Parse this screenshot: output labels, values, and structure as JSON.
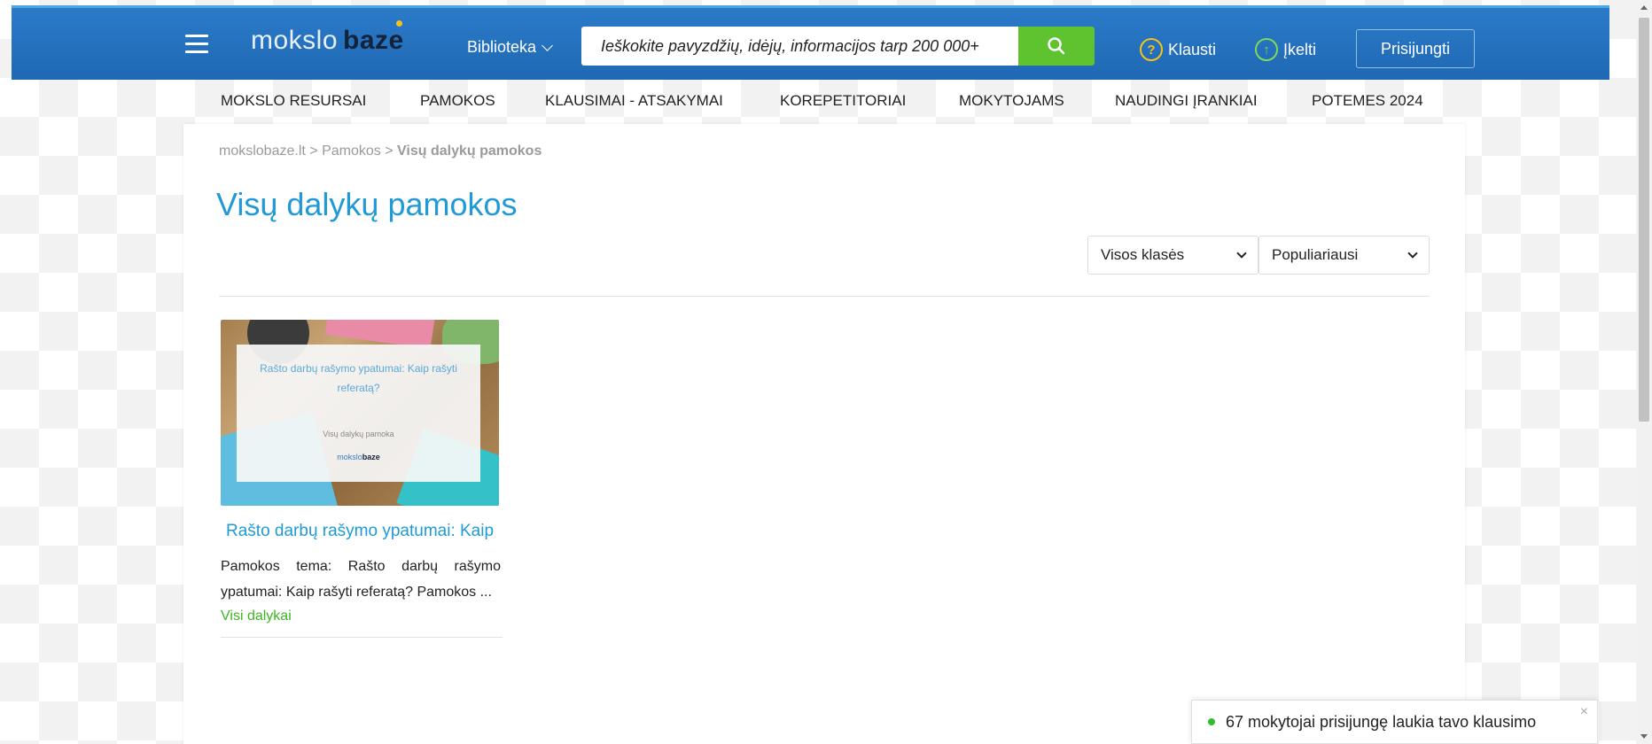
{
  "header": {
    "logo_light": "mokslo",
    "logo_bold": "baze",
    "library_label": "Biblioteka",
    "search_placeholder": "Ieškokite pavyzdžių, idėjų, informacijos tarp 200 000+",
    "ask_label": "Klausti",
    "upload_label": "Įkelti",
    "login_label": "Prisijungti",
    "icons": {
      "menu": "hamburger-icon",
      "search": "search-icon",
      "ask": "question-circle-icon",
      "upload": "arrow-up-circle-icon"
    },
    "colors": {
      "bar": "#2272bd",
      "search_button": "#5fc22f"
    }
  },
  "nav": {
    "items": [
      {
        "label": "MOKSLO RESURSAI"
      },
      {
        "label": "PAMOKOS"
      },
      {
        "label": "KLAUSIMAI - ATSAKYMAI"
      },
      {
        "label": "KOREPETITORIAI"
      },
      {
        "label": "MOKYTOJAMS"
      },
      {
        "label": "NAUDINGI ĮRANKIAI"
      },
      {
        "label": "POTEMES 2024"
      }
    ]
  },
  "breadcrumb": {
    "home": "mokslobaze.lt",
    "sep": ">",
    "section": "Pamokos",
    "current": "Visų dalykų pamokos"
  },
  "page": {
    "title": "Visų dalykų pamokos",
    "filter_grade": "Visos klasės",
    "filter_sort": "Populiariausi"
  },
  "lessons": [
    {
      "thumb_title": "Rašto darbų rašymo ypatumai: Kaip rašyti referatą?",
      "thumb_subtitle": "Visų dalykų pamoka",
      "thumb_logo_light": "mokslo",
      "thumb_logo_bold": "baze",
      "title": "Rašto darbų rašymo ypatumai: Kaip",
      "description": "Pamokos tema: Rašto darbų rašymo ypatumai: Kaip rašyti referatą? Pamokos ...",
      "tag": "Visi dalykai"
    }
  ],
  "notification": {
    "text": "67 mokytojai prisijungę laukia tavo klausimo",
    "close": "×"
  }
}
